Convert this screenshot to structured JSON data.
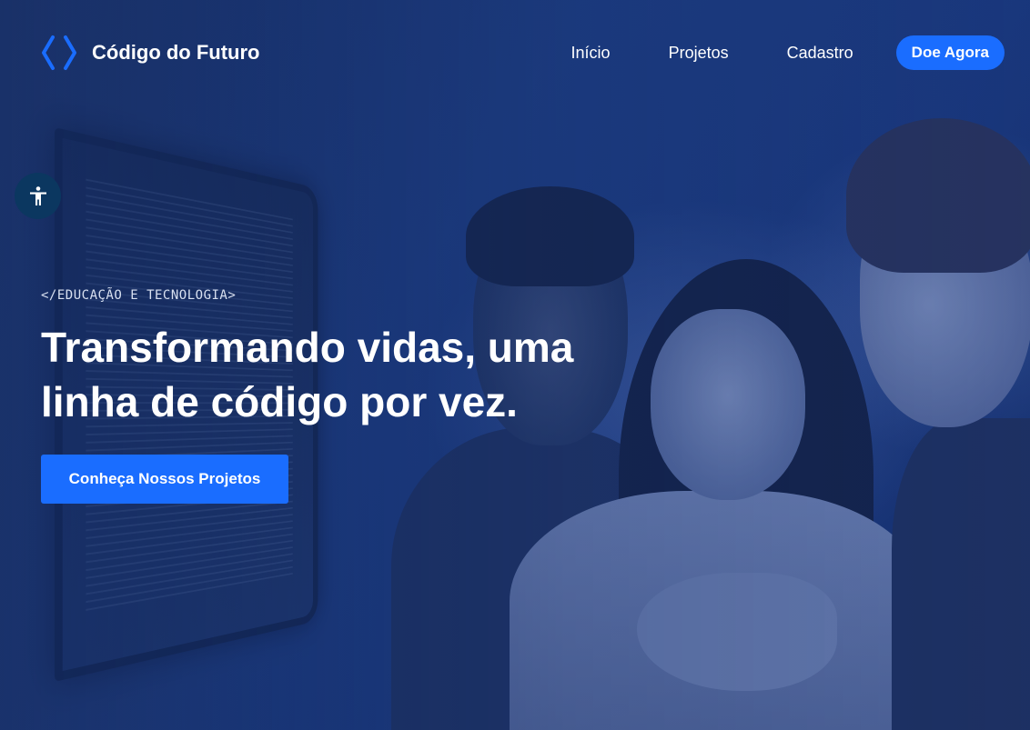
{
  "header": {
    "brand_name": "Código do Futuro",
    "logo_icon": "code-brackets-icon",
    "nav": {
      "inicio": "Início",
      "projetos": "Projetos",
      "cadastro": "Cadastro"
    },
    "donate_label": "Doe Agora"
  },
  "accessibility": {
    "icon": "accessibility-person-icon"
  },
  "hero": {
    "eyebrow": "</EDUCAÇÃO E TECNOLOGIA>",
    "headline": "Transformando vidas, uma linha de código por vez.",
    "cta_label": "Conheça Nossos Projetos"
  },
  "colors": {
    "accent": "#1a6dff",
    "overlay": "#1e3f86",
    "accessibility_bg": "#0b3760",
    "text": "#ffffff"
  }
}
